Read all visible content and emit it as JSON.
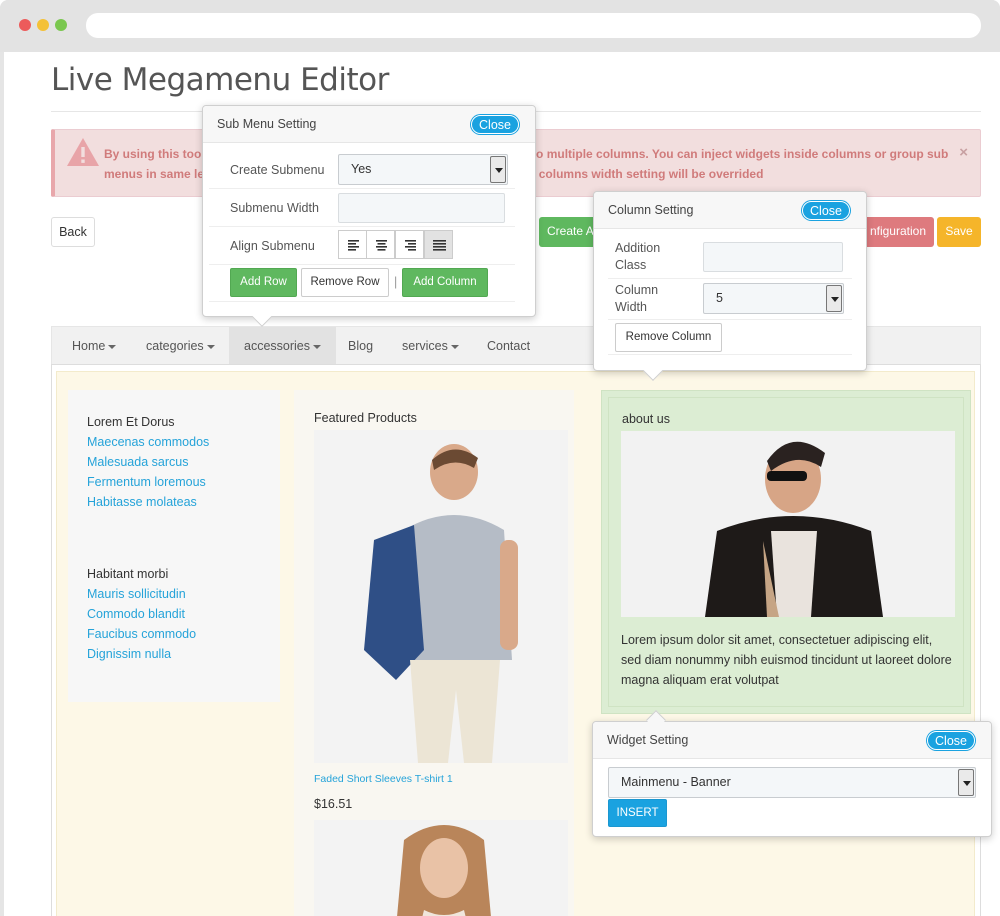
{
  "page": {
    "title": "Live Megamenu Editor"
  },
  "alert": {
    "text": "By using this tool you can change the menu layout as you want, divide it into multiple columns. You can inject widgets inside columns or group sub menus in same level. Note that when you change the width of submenu, the columns width setting will be overrided",
    "close": "×"
  },
  "toolbar": {
    "back": "Back",
    "create": "Create A",
    "configuration": "nfiguration",
    "save": "Save"
  },
  "nav": {
    "items": [
      {
        "label": "Home"
      },
      {
        "label": "categories"
      },
      {
        "label": "accessories"
      },
      {
        "label": "Blog"
      },
      {
        "label": "services"
      },
      {
        "label": "Contact"
      }
    ]
  },
  "col1": {
    "groups": [
      {
        "title": "Lorem Et Dorus",
        "links": [
          "Maecenas commodos",
          "Malesuada sarcus",
          "Fermentum loremous",
          "Habitasse molateas"
        ]
      },
      {
        "title": "Habitant morbi",
        "links": [
          "Mauris sollicitudin",
          "Commodo blandit",
          "Faucibus commodo",
          "Dignissim nulla"
        ]
      }
    ]
  },
  "col2": {
    "title": "Featured Products",
    "product": {
      "name": "Faded Short Sleeves T-shirt 1",
      "price": "$16.51"
    }
  },
  "col3": {
    "title": "about us",
    "text": "Lorem ipsum dolor sit amet, consectetuer adipiscing elit, sed diam nonummy nibh euismod tincidunt ut laoreet dolore magna aliquam erat volutpat"
  },
  "submenu_popup": {
    "title": "Sub Menu Setting",
    "close": "Close",
    "create_label": "Create Submenu",
    "create_value": "Yes",
    "width_label": "Submenu Width",
    "width_value": "",
    "align_label": "Align Submenu",
    "add_row": "Add Row",
    "remove_row": "Remove Row",
    "separator": "|",
    "add_column": "Add Column"
  },
  "column_popup": {
    "title": "Column Setting",
    "close": "Close",
    "class_label": "Addition Class",
    "class_value": "",
    "width_label": "Column Width",
    "width_value": "5",
    "remove_column": "Remove Column"
  },
  "widget_popup": {
    "title": "Widget Setting",
    "close": "Close",
    "widget_value": "Mainmenu - Banner",
    "insert": "INSERT"
  },
  "colors": {
    "accent": "#1aa2e0",
    "green": "#5fb85f",
    "alert_bg": "#f2dede",
    "link": "#25a3d9"
  }
}
